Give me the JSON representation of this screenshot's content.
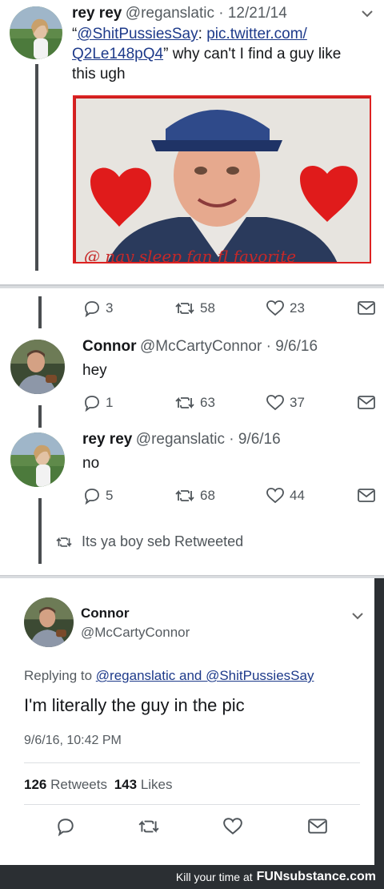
{
  "tweet1": {
    "name": "rey rey",
    "handle_date": "@reganslatic · 12/21/14",
    "quote_open": "“",
    "mention": "@ShitPussiesSay",
    "colon": ":",
    "link_a": "pic.twitter.com/",
    "link_b": "Q2Le148pQ4",
    "text_rest": "” why can't I find a guy like",
    "text_line3": "this ugh"
  },
  "thread": {
    "first_actions": {
      "replies": "3",
      "retweets": "58",
      "likes": "23"
    },
    "reply1": {
      "name": "Connor",
      "handle_date": "@McCartyConnor · 9/6/16",
      "text": "hey",
      "actions": {
        "replies": "1",
        "retweets": "63",
        "likes": "37"
      }
    },
    "reply2": {
      "name": "rey rey",
      "handle_date": "@reganslatic · 9/6/16",
      "text": "no",
      "actions": {
        "replies": "5",
        "retweets": "68",
        "likes": "44"
      }
    },
    "retweeted_by": "Its ya boy seb Retweeted"
  },
  "detail": {
    "name": "Connor",
    "handle": "@McCartyConnor",
    "replying_prefix": "Replying to",
    "replying_target": "@reganslatic and @ShitPussiesSay",
    "text": "I'm literally the guy in the pic",
    "timestamp": "9/6/16, 10:42 PM",
    "retweets_count": "126",
    "retweets_label": "Retweets",
    "likes_count": "143",
    "likes_label": "Likes"
  },
  "footer": {
    "tagline": "Kill your time at",
    "brand": "FUNsubstance.com"
  },
  "colors": {
    "heart": "#e01b1b",
    "footer_bg": "#2b2f33",
    "link": "#1d3a8a"
  }
}
